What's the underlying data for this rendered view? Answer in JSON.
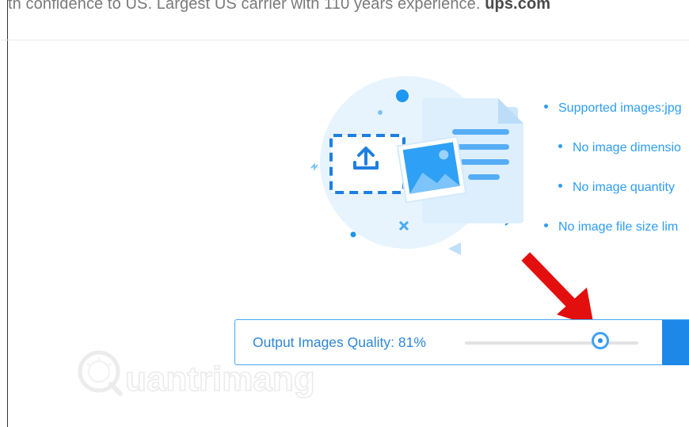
{
  "ad": {
    "text": "th confidence to US. Largest US carrier with 110 years experience.",
    "domain": "ups.com"
  },
  "features": [
    "Supported images:jpg",
    "No image dimensio",
    "No image quantity",
    "No image file size lim"
  ],
  "quality": {
    "label": "Output Images Quality:",
    "value": "81%",
    "level": 0.81
  },
  "watermark": {
    "text": "uantrimang"
  },
  "colors": {
    "accent": "#2e9df3",
    "button": "#1e88e8",
    "arrow": "#e30f0f"
  }
}
